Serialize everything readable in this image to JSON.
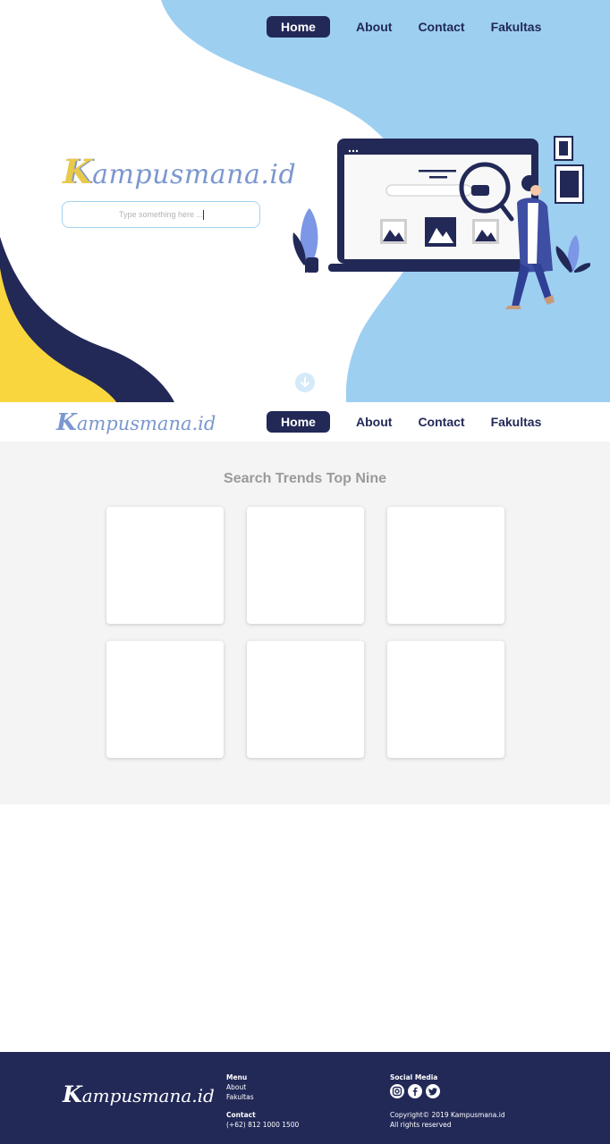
{
  "nav": {
    "home": "Home",
    "about": "About",
    "contact": "Contact",
    "fakultas": "Fakultas"
  },
  "brand": {
    "k": "K",
    "rest": "ampusmana.id"
  },
  "search": {
    "placeholder": "Type something here ..."
  },
  "trends": {
    "title": "Search Trends Top Nine"
  },
  "footer": {
    "menu_heading": "Menu",
    "menu_items": [
      "About",
      "Fakultas"
    ],
    "contact_heading": "Contact",
    "phone": "(+62) 812 1000 1500",
    "social_heading": "Social Media",
    "social_icons": [
      "instagram-icon",
      "facebook-icon",
      "twitter-icon"
    ],
    "copyright": "Copyright© 2019 Kampusmana.id",
    "rights": "All rights reserved"
  },
  "colors": {
    "navy": "#222957",
    "light_blue": "#9dcff1",
    "yellow": "#f9d63d",
    "trends_bg": "#f4f4f4"
  }
}
